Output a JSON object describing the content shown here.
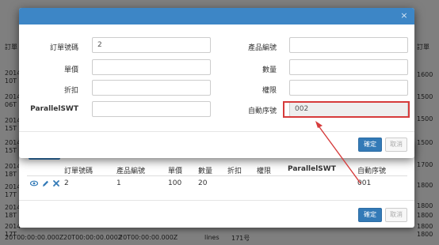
{
  "background": {
    "left_fragments": [
      "訂單",
      "2014",
      "10T",
      "2014",
      "06T",
      "2014",
      "15T",
      "2014",
      "15T",
      "2014",
      "18T",
      "2014",
      "17T",
      "2014",
      "18T",
      "2014",
      "17T"
    ],
    "right_fragments": [
      "訂單",
      "1600",
      "1500",
      "1500",
      "1500",
      "1700",
      "1800",
      "1800",
      "1800",
      "1800",
      "1800"
    ],
    "bottom_row": [
      "20T00:00:00.000Z",
      "20T00:00:00.000Z",
      "20T00:00:00.000Z",
      "lines",
      "171号"
    ]
  },
  "front_modal": {
    "close_glyph": "×",
    "fields": {
      "order_no": {
        "label": "訂單號碼",
        "value": "2"
      },
      "product_code": {
        "label": "產品編號",
        "value": ""
      },
      "unit_price": {
        "label": "單價",
        "value": ""
      },
      "quantity": {
        "label": "數量",
        "value": ""
      },
      "discount": {
        "label": "折扣",
        "value": ""
      },
      "permission": {
        "label": "權限",
        "value": ""
      },
      "parallel_swt": {
        "label": "ParallelSWT",
        "value": ""
      },
      "auto_serial": {
        "label": "自動序號",
        "value": "002"
      }
    },
    "confirm_label": "確定",
    "cancel_label": "取消"
  },
  "back_modal": {
    "columns": [
      "訂單號碼",
      "產品編號",
      "單價",
      "數量",
      "折扣",
      "權限",
      "ParallelSWT",
      "自動序號"
    ],
    "row": {
      "order_no": "2",
      "product_code": "1",
      "unit_price": "100",
      "quantity": "20",
      "discount": "",
      "permission": "",
      "parallel_swt": "",
      "auto_serial": "001"
    },
    "row_icons": [
      "eye-icon",
      "pencil-icon",
      "delete-x-icon"
    ],
    "confirm_label": "確定",
    "cancel_label": "取消"
  },
  "colors": {
    "modal_header": "#3d86c6",
    "primary_button": "#337ab7",
    "annotation": "#d63b3b"
  }
}
